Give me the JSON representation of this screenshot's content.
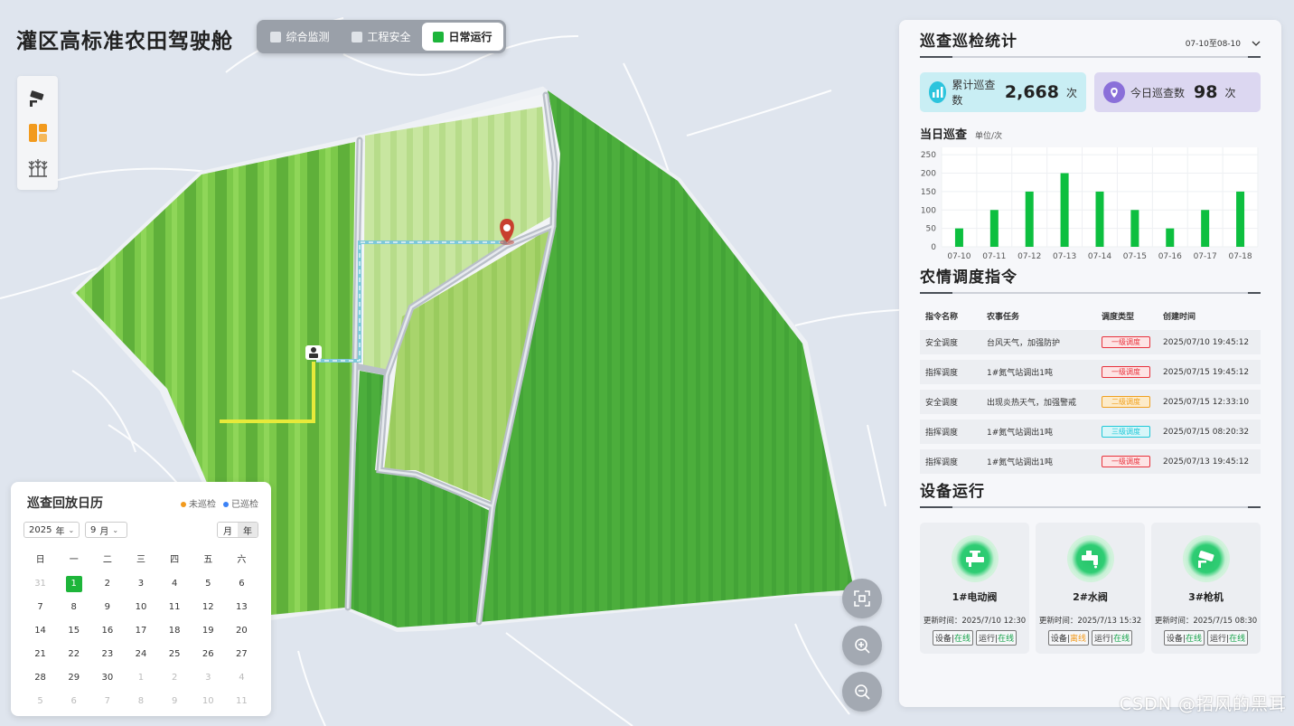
{
  "app": {
    "title": "灌区高标准农田驾驶舱"
  },
  "tabs": [
    {
      "label": "综合监测",
      "icon": "monitor-icon",
      "active": false
    },
    {
      "label": "工程安全",
      "icon": "building-icon",
      "active": false
    },
    {
      "label": "日常运行",
      "icon": "plant-icon",
      "active": true
    }
  ],
  "toolbar": [
    {
      "name": "camera-icon"
    },
    {
      "name": "field-map-icon"
    },
    {
      "name": "crop-icon"
    }
  ],
  "calendar": {
    "title": "巡查回放日历",
    "legend": {
      "unchecked": "未巡检",
      "checked": "已巡检",
      "unchecked_color": "#f29a1d",
      "checked_color": "#3b82f6"
    },
    "year": "2025",
    "year_unit": "年",
    "month": "9",
    "month_unit": "月",
    "view_month": "月",
    "view_year": "年",
    "weekdays": [
      "日",
      "一",
      "二",
      "三",
      "四",
      "五",
      "六"
    ],
    "days": [
      {
        "d": "31",
        "m": true
      },
      {
        "d": "1",
        "today": true,
        "dot": true
      },
      {
        "d": "2",
        "dot": true
      },
      {
        "d": "3",
        "dot": true
      },
      {
        "d": "4",
        "dot": true
      },
      {
        "d": "5",
        "dot": true
      },
      {
        "d": "6",
        "dot": true
      },
      {
        "d": "7",
        "dot": true
      },
      {
        "d": "8",
        "dot": true
      },
      {
        "d": "9",
        "dot": true
      },
      {
        "d": "10",
        "dot": true
      },
      {
        "d": "11",
        "dot": true
      },
      {
        "d": "12",
        "dot": true
      },
      {
        "d": "13",
        "dot": true
      },
      {
        "d": "14",
        "dot": true
      },
      {
        "d": "15",
        "dot": true
      },
      {
        "d": "16",
        "dot": true
      },
      {
        "d": "17",
        "dot": true
      },
      {
        "d": "18",
        "dot": true
      },
      {
        "d": "19",
        "dot": true
      },
      {
        "d": "20",
        "dot": true
      },
      {
        "d": "21",
        "dot": true
      },
      {
        "d": "22",
        "dot": true
      },
      {
        "d": "23",
        "dot": true
      },
      {
        "d": "24",
        "dot": true
      },
      {
        "d": "25",
        "dot": true
      },
      {
        "d": "26",
        "dot": true
      },
      {
        "d": "27",
        "dot": true
      },
      {
        "d": "28",
        "dot": true
      },
      {
        "d": "29",
        "dot": true
      },
      {
        "d": "30",
        "dot": true
      },
      {
        "d": "1",
        "m": true
      },
      {
        "d": "2",
        "m": true
      },
      {
        "d": "3",
        "m": true
      },
      {
        "d": "4",
        "m": true
      },
      {
        "d": "5",
        "m": true
      },
      {
        "d": "6",
        "m": true
      },
      {
        "d": "7",
        "m": true
      },
      {
        "d": "8",
        "m": true
      },
      {
        "d": "9",
        "m": true
      },
      {
        "d": "10",
        "m": true
      },
      {
        "d": "11",
        "m": true
      }
    ]
  },
  "inspection": {
    "title": "巡查巡检统计",
    "range": "07-10至08-10",
    "total_label": "累计巡查数",
    "total_value": "2,668",
    "total_unit": "次",
    "today_label": "今日巡查数",
    "today_value": "98",
    "today_unit": "次",
    "chart_title": "当日巡查",
    "chart_unit": "单位/次"
  },
  "chart_data": {
    "type": "bar",
    "title": "当日巡查",
    "ylabel": "单位/次",
    "categories": [
      "07-10",
      "07-11",
      "07-12",
      "07-13",
      "07-14",
      "07-15",
      "07-16",
      "07-17",
      "07-18"
    ],
    "values": [
      50,
      100,
      150,
      200,
      150,
      100,
      50,
      100,
      150
    ],
    "yticks": [
      0,
      50,
      100,
      150,
      200,
      250
    ],
    "ylim": [
      0,
      270
    ],
    "grid": true,
    "color": "#0dbf3f"
  },
  "dispatch": {
    "title": "农情调度指令",
    "headers": [
      "指令名称",
      "农事任务",
      "调度类型",
      "创建时间"
    ],
    "rows": [
      {
        "name": "安全调度",
        "task": "台风天气，加强防护",
        "type": "一级调度",
        "level": "red",
        "time": "2025/07/10 19:45:12"
      },
      {
        "name": "指挥调度",
        "task": "1#氮气站调出1吨",
        "type": "一级调度",
        "level": "red",
        "time": "2025/07/15 19:45:12"
      },
      {
        "name": "安全调度",
        "task": "出现炎热天气，加强警戒",
        "type": "二级调度",
        "level": "orange",
        "time": "2025/07/15 12:33:10"
      },
      {
        "name": "指挥调度",
        "task": "1#氮气站调出1吨",
        "type": "三级调度",
        "level": "cyan",
        "time": "2025/07/15 08:20:32"
      },
      {
        "name": "指挥调度",
        "task": "1#氮气站调出1吨",
        "type": "一级调度",
        "level": "red",
        "time": "2025/07/13 19:45:12"
      }
    ],
    "level_colors": {
      "red": "#e8323c",
      "orange": "#f0a020",
      "cyan": "#1fc8d8"
    }
  },
  "devices": {
    "title": "设备运行",
    "items": [
      {
        "name": "1#电动阀",
        "icon": "electric-valve-icon",
        "time_label": "更新时间：",
        "time": "2025/7/10 12:30",
        "dev_label": "设备",
        "dev_status": "在线",
        "dev_color": "green",
        "run_label": "运行",
        "run_status": "在线",
        "run_color": "green"
      },
      {
        "name": "2#水阀",
        "icon": "water-valve-icon",
        "time_label": "更新时间：",
        "time": "2025/7/13 15:32",
        "dev_label": "设备",
        "dev_status": "离线",
        "dev_color": "orange",
        "run_label": "运行",
        "run_status": "在线",
        "run_color": "green"
      },
      {
        "name": "3#枪机",
        "icon": "camera-gun-icon",
        "time_label": "更新时间：",
        "time": "2025/7/15 08:30",
        "dev_label": "设备",
        "dev_status": "在线",
        "dev_color": "green",
        "run_label": "运行",
        "run_status": "在线",
        "run_color": "green"
      }
    ]
  },
  "watermark": "CSDN @招风的黑耳"
}
